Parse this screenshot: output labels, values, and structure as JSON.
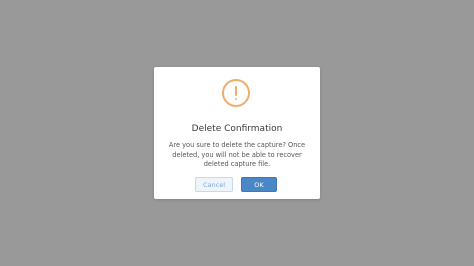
{
  "dialog": {
    "icon": "warning-exclamation-icon",
    "title": "Delete Confirmation",
    "message": "Are you sure to delete the capture? Once deleted, you will not be able to recover deleted capture file.",
    "cancel_label": "Cancel",
    "ok_label": "OK"
  },
  "colors": {
    "overlay": "#999999",
    "warning": "#f0ad6a",
    "primary": "#4a87c6"
  }
}
